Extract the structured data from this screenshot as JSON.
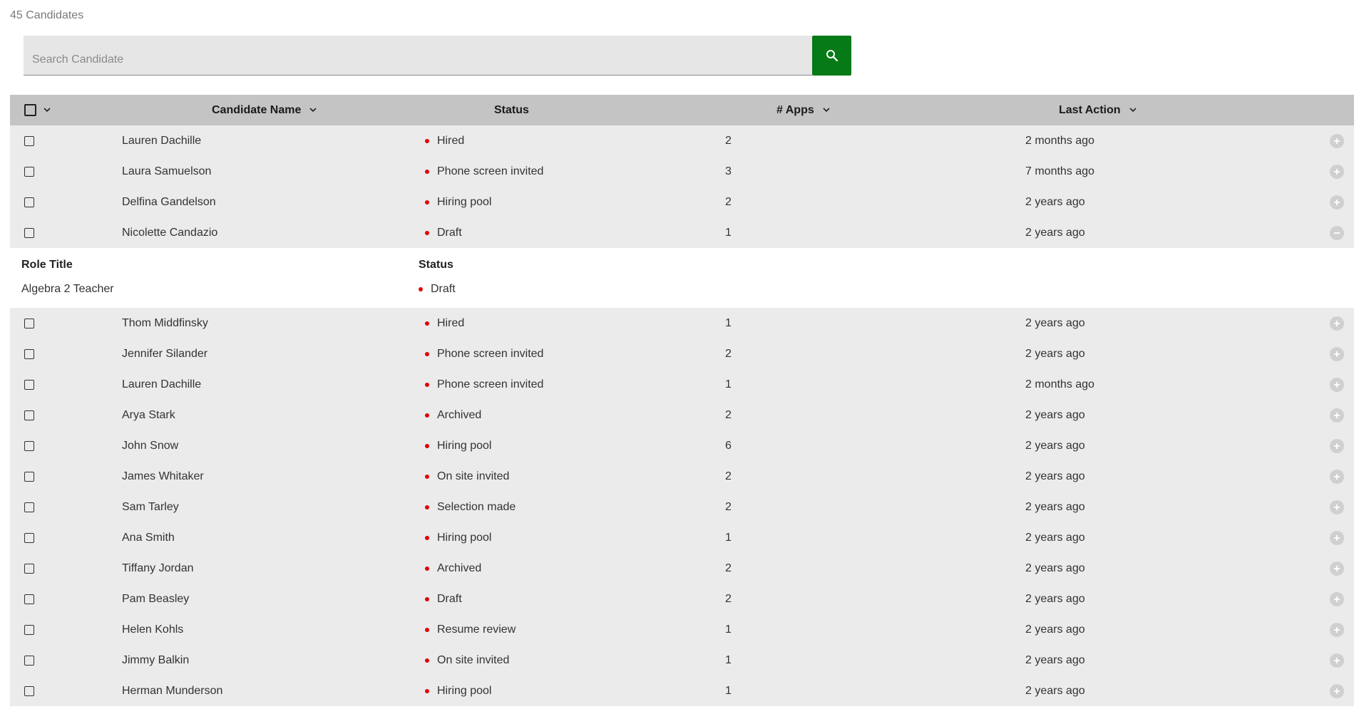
{
  "header": {
    "count_label": "45 Candidates"
  },
  "search": {
    "placeholder": "Search Candidate",
    "value": "",
    "button_icon": "search-icon"
  },
  "colors": {
    "accent": "#057a16",
    "status_dot": "#e00000",
    "header_bg": "#c4c4c4",
    "row_bg": "#ebebeb"
  },
  "table": {
    "columns": {
      "name": "Candidate Name",
      "status": "Status",
      "apps": "# Apps",
      "last_action": "Last Action"
    },
    "rows": [
      {
        "name": "Lauren Dachille",
        "status": "Hired",
        "apps": "2",
        "last_action": "2 months ago",
        "expanded": false
      },
      {
        "name": "Laura Samuelson",
        "status": "Phone screen invited",
        "apps": "3",
        "last_action": "7 months ago",
        "expanded": false
      },
      {
        "name": "Delfina Gandelson",
        "status": "Hiring pool",
        "apps": "2",
        "last_action": "2 years ago",
        "expanded": false
      },
      {
        "name": "Nicolette Candazio",
        "status": "Draft",
        "apps": "1",
        "last_action": "2 years ago",
        "expanded": true,
        "detail": {
          "role_title_label": "Role Title",
          "status_label": "Status",
          "role_title": "Algebra 2 Teacher",
          "status": "Draft"
        }
      },
      {
        "name": "Thom Middfinsky",
        "status": "Hired",
        "apps": "1",
        "last_action": "2 years ago",
        "expanded": false
      },
      {
        "name": "Jennifer Silander",
        "status": "Phone screen invited",
        "apps": "2",
        "last_action": "2 years ago",
        "expanded": false
      },
      {
        "name": "Lauren Dachille",
        "status": "Phone screen invited",
        "apps": "1",
        "last_action": "2 months ago",
        "expanded": false
      },
      {
        "name": "Arya Stark",
        "status": "Archived",
        "apps": "2",
        "last_action": "2 years ago",
        "expanded": false
      },
      {
        "name": "John Snow",
        "status": "Hiring pool",
        "apps": "6",
        "last_action": "2 years ago",
        "expanded": false
      },
      {
        "name": "James Whitaker",
        "status": "On site invited",
        "apps": "2",
        "last_action": "2 years ago",
        "expanded": false
      },
      {
        "name": "Sam Tarley",
        "status": "Selection made",
        "apps": "2",
        "last_action": "2 years ago",
        "expanded": false
      },
      {
        "name": "Ana Smith",
        "status": "Hiring pool",
        "apps": "1",
        "last_action": "2 years ago",
        "expanded": false
      },
      {
        "name": "Tiffany Jordan",
        "status": "Archived",
        "apps": "2",
        "last_action": "2 years ago",
        "expanded": false
      },
      {
        "name": "Pam Beasley",
        "status": "Draft",
        "apps": "2",
        "last_action": "2 years ago",
        "expanded": false
      },
      {
        "name": "Helen Kohls",
        "status": "Resume review",
        "apps": "1",
        "last_action": "2 years ago",
        "expanded": false
      },
      {
        "name": "Jimmy Balkin",
        "status": "On site invited",
        "apps": "1",
        "last_action": "2 years ago",
        "expanded": false
      },
      {
        "name": "Herman Munderson",
        "status": "Hiring pool",
        "apps": "1",
        "last_action": "2 years ago",
        "expanded": false
      }
    ]
  }
}
